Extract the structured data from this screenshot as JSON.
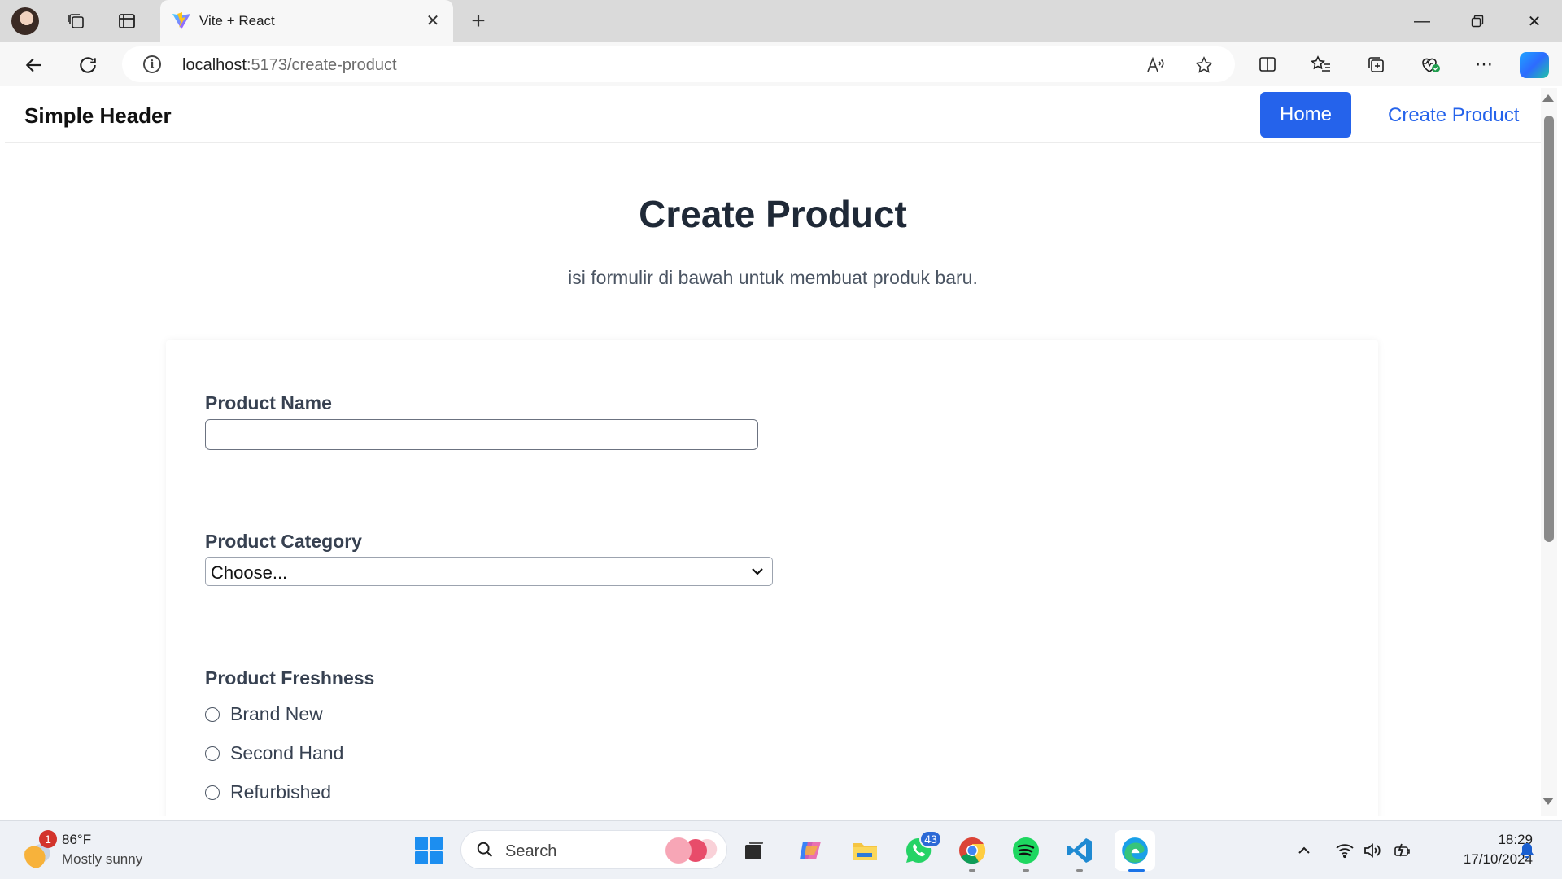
{
  "browser": {
    "tab_title": "Vite + React",
    "url_host": "localhost",
    "url_rest": ":5173/create-product",
    "icons": [
      "profile-avatar",
      "workspaces-icon",
      "tab-actions-icon",
      "vite-logo",
      "close-icon",
      "plus-icon",
      "minimize-icon",
      "restore-icon",
      "close-window-icon",
      "back-icon",
      "refresh-icon",
      "info-icon",
      "read-aloud-icon",
      "star-icon",
      "split-screen-icon",
      "favorites-icon",
      "collections-icon",
      "browser-essentials-icon",
      "more-icon",
      "copilot-icon"
    ]
  },
  "header": {
    "brand": "Simple Header",
    "nav": {
      "home": "Home",
      "create_product": "Create Product"
    },
    "accent": "#2563eb"
  },
  "main": {
    "title": "Create Product",
    "subtitle": "isi formulir di bawah untuk membuat produk baru."
  },
  "form": {
    "product_name": {
      "label": "Product Name",
      "value": ""
    },
    "product_category": {
      "label": "Product Category",
      "selected": "Choose..."
    },
    "product_freshness": {
      "label": "Product Freshness",
      "options": [
        "Brand New",
        "Second Hand",
        "Refurbished"
      ]
    }
  },
  "taskbar": {
    "weather": {
      "badge": "1",
      "temp": "86°F",
      "desc": "Mostly sunny"
    },
    "search_placeholder": "Search",
    "whatsapp_badge": "43",
    "clock": {
      "time": "18:29",
      "date": "17/10/2024"
    }
  }
}
